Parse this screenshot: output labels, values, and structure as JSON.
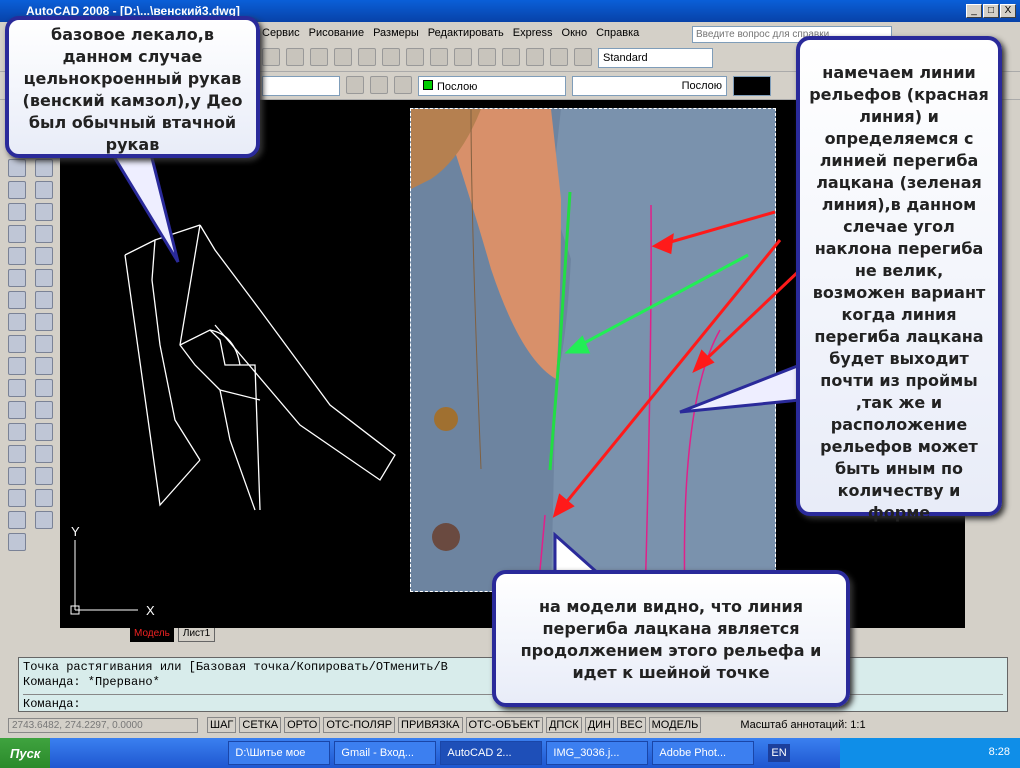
{
  "window": {
    "title": "AutoCAD 2008 - [D:\\...\\венский3.dwg]",
    "min": "_",
    "max": "□",
    "close": "X"
  },
  "menu": [
    "Сервис",
    "Рисование",
    "Размеры",
    "Редактировать",
    "Express",
    "Окно",
    "Справка"
  ],
  "help_placeholder": "Введите вопрос для справки",
  "toolbar": {
    "text_style": "Standard",
    "color": "Послою",
    "linetype": "Послою"
  },
  "tabs": {
    "model": "Модель",
    "layout1": "Лист1"
  },
  "axes": {
    "y": "Y",
    "x": "X"
  },
  "command": {
    "line1": "Точка растягивания или [Базовая точка/Копировать/ОТменить/В",
    "line2": "Команда: *Прервано*",
    "prompt": "Команда:"
  },
  "status": {
    "coords": "2743.6482, 274.2297, 0.0000",
    "buttons": [
      "ШАГ",
      "СЕТКА",
      "ОРТО",
      "ОТС-ПОЛЯР",
      "ПРИВЯЗКА",
      "ОТС-ОБЪЕКТ",
      "ДПСК",
      "ДИН",
      "ВЕС",
      "МОДЕЛЬ"
    ],
    "annotation_scale": "Масштаб аннотаций:",
    "scale_value": "1:1"
  },
  "taskbar": {
    "start": "Пуск",
    "tasks": [
      "D:\\Шитье мое",
      "Gmail - Вход...",
      "AutoCAD 2...",
      "IMG_3036.j...",
      "Adobe Phot..."
    ],
    "active": 2,
    "lang": "EN",
    "clock": "8:28"
  },
  "callouts": {
    "left": "базовое лекало,в данном случае цельнокроенный рукав (венский камзол),у Део был обычный втачной рукав",
    "right": "намечаем линии рельефов (красная линия) и определяемся с линией перегиба лацкана (зеленая линия),в данном слечае угол наклона перегиба не велик, возможен вариант когда линия перегиба лацкана будет выходит почти из проймы ,так же и расположение рельефов может быть иным по количеству и форме",
    "bottom": "на модели видно, что линия перегиба лацкана является продолжением этого рельефа и идет к шейной точке"
  },
  "colors": {
    "relief": "#ff1a1a",
    "fold": "#22dd44",
    "seam": "#e0208a"
  }
}
